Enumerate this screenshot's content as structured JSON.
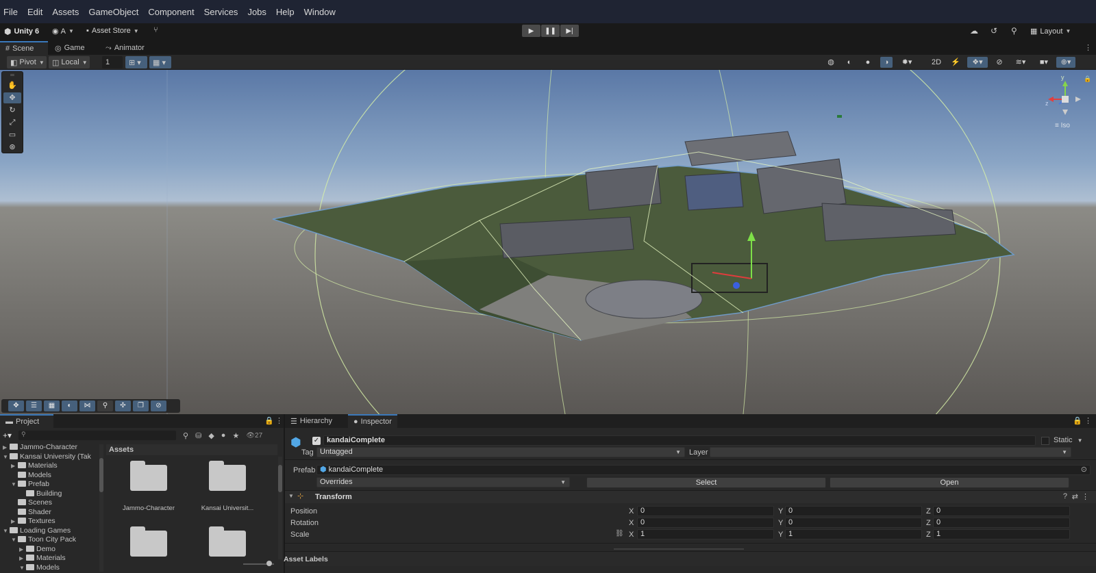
{
  "menu": [
    "File",
    "Edit",
    "Assets",
    "GameObject",
    "Component",
    "Services",
    "Jobs",
    "Help",
    "Window"
  ],
  "toolbar": {
    "unity_label": "Unity 6",
    "account": "A",
    "asset_store": "Asset Store",
    "layout": "Layout"
  },
  "tabs": {
    "scene": "Scene",
    "game": "Game",
    "animator": "Animator"
  },
  "scene_toolbar": {
    "pivot": "Pivot",
    "local": "Local",
    "snap_value": "1",
    "mode_2d": "2D"
  },
  "gizmo": {
    "iso_label": "Iso",
    "y": "y",
    "z": "z"
  },
  "project": {
    "tab": "Project",
    "count": "27",
    "assets_header": "Assets",
    "tree": [
      {
        "label": "Jammo-Character",
        "indent": 1,
        "expanded": false
      },
      {
        "label": "Kansai University (Tak",
        "indent": 1,
        "expanded": true
      },
      {
        "label": "Materials",
        "indent": 2,
        "expanded": false
      },
      {
        "label": "Models",
        "indent": 2,
        "expanded": null
      },
      {
        "label": "Prefab",
        "indent": 2,
        "expanded": true
      },
      {
        "label": "Building",
        "indent": 3,
        "expanded": null
      },
      {
        "label": "Scenes",
        "indent": 2,
        "expanded": null
      },
      {
        "label": "Shader",
        "indent": 2,
        "expanded": null
      },
      {
        "label": "Textures",
        "indent": 2,
        "expanded": false
      },
      {
        "label": "Loading Games",
        "indent": 1,
        "expanded": true
      },
      {
        "label": "Toon City Pack",
        "indent": 2,
        "expanded": true
      },
      {
        "label": "Demo",
        "indent": 3,
        "expanded": false
      },
      {
        "label": "Materials",
        "indent": 3,
        "expanded": false
      },
      {
        "label": "Models",
        "indent": 3,
        "expanded": true
      }
    ],
    "assets": [
      {
        "label": "Jammo-Character"
      },
      {
        "label": "Kansai Universit..."
      },
      {
        "label": ""
      },
      {
        "label": ""
      }
    ]
  },
  "inspector": {
    "tab_hierarchy": "Hierarchy",
    "tab_inspector": "Inspector",
    "object_name": "kandaiComplete",
    "static_label": "Static",
    "tag_label": "Tag",
    "tag_value": "Untagged",
    "layer_label": "Layer",
    "layer_value": "",
    "prefab_label": "Prefab",
    "prefab_value": "kandaiComplete",
    "overrides": "Overrides",
    "select": "Select",
    "open": "Open",
    "transform_title": "Transform",
    "position_label": "Position",
    "rotation_label": "Rotation",
    "scale_label": "Scale",
    "position": {
      "x": "0",
      "y": "0",
      "z": "0"
    },
    "rotation": {
      "x": "0",
      "y": "0",
      "z": "0"
    },
    "scale": {
      "x": "1",
      "y": "1",
      "z": "1"
    },
    "axis_x": "X",
    "axis_y": "Y",
    "axis_z": "Z",
    "asset_labels": "Asset Labels"
  },
  "colors": {
    "accent": "#3a79bb",
    "menubar_bg": "#1f2433",
    "panel_bg": "#282828",
    "selected_btn": "#46607c"
  }
}
